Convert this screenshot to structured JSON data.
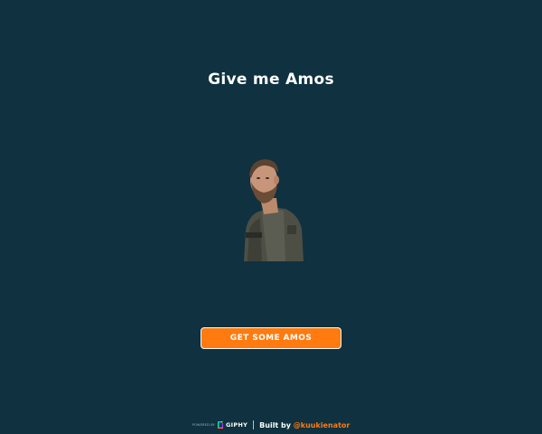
{
  "page": {
    "title": "Give me Amos"
  },
  "gif": {
    "description_icon": "gif-image"
  },
  "button": {
    "label": "GET SOME AMOS"
  },
  "footer": {
    "powered_by": "POWERED BY",
    "giphy": "GIPHY",
    "built_by": "Built by",
    "handle": "@kuukienator"
  },
  "colors": {
    "background": "#10313f",
    "accent": "#ff7a0f",
    "text": "#ffffff"
  }
}
